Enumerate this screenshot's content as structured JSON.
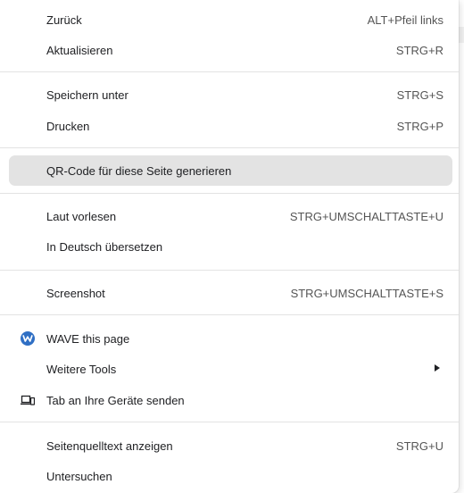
{
  "menu": {
    "items": [
      {
        "label": "Zurück",
        "shortcut": "ALT+Pfeil links"
      },
      {
        "label": "Aktualisieren",
        "shortcut": "STRG+R"
      },
      {
        "label": "Speichern unter",
        "shortcut": "STRG+S"
      },
      {
        "label": "Drucken",
        "shortcut": "STRG+P"
      },
      {
        "label": "QR-Code für diese Seite generieren",
        "shortcut": ""
      },
      {
        "label": "Laut vorlesen",
        "shortcut": "STRG+UMSCHALTTASTE+U"
      },
      {
        "label": "In Deutsch übersetzen",
        "shortcut": ""
      },
      {
        "label": "Screenshot",
        "shortcut": "STRG+UMSCHALTTASTE+S"
      },
      {
        "label": "WAVE this page",
        "shortcut": "",
        "icon": "wave-extension-icon"
      },
      {
        "label": "Weitere Tools",
        "shortcut": "",
        "icon": "chevron-right-icon"
      },
      {
        "label": "Tab an Ihre Geräte senden",
        "shortcut": "",
        "icon": "devices-icon"
      },
      {
        "label": "Seitenquelltext anzeigen",
        "shortcut": "STRG+U"
      },
      {
        "label": "Untersuchen",
        "shortcut": ""
      }
    ]
  },
  "colors": {
    "highlight": "#e3e3e3",
    "wave_icon": "#2f6fc4",
    "text": "#202124",
    "shortcut_text": "#555555"
  }
}
